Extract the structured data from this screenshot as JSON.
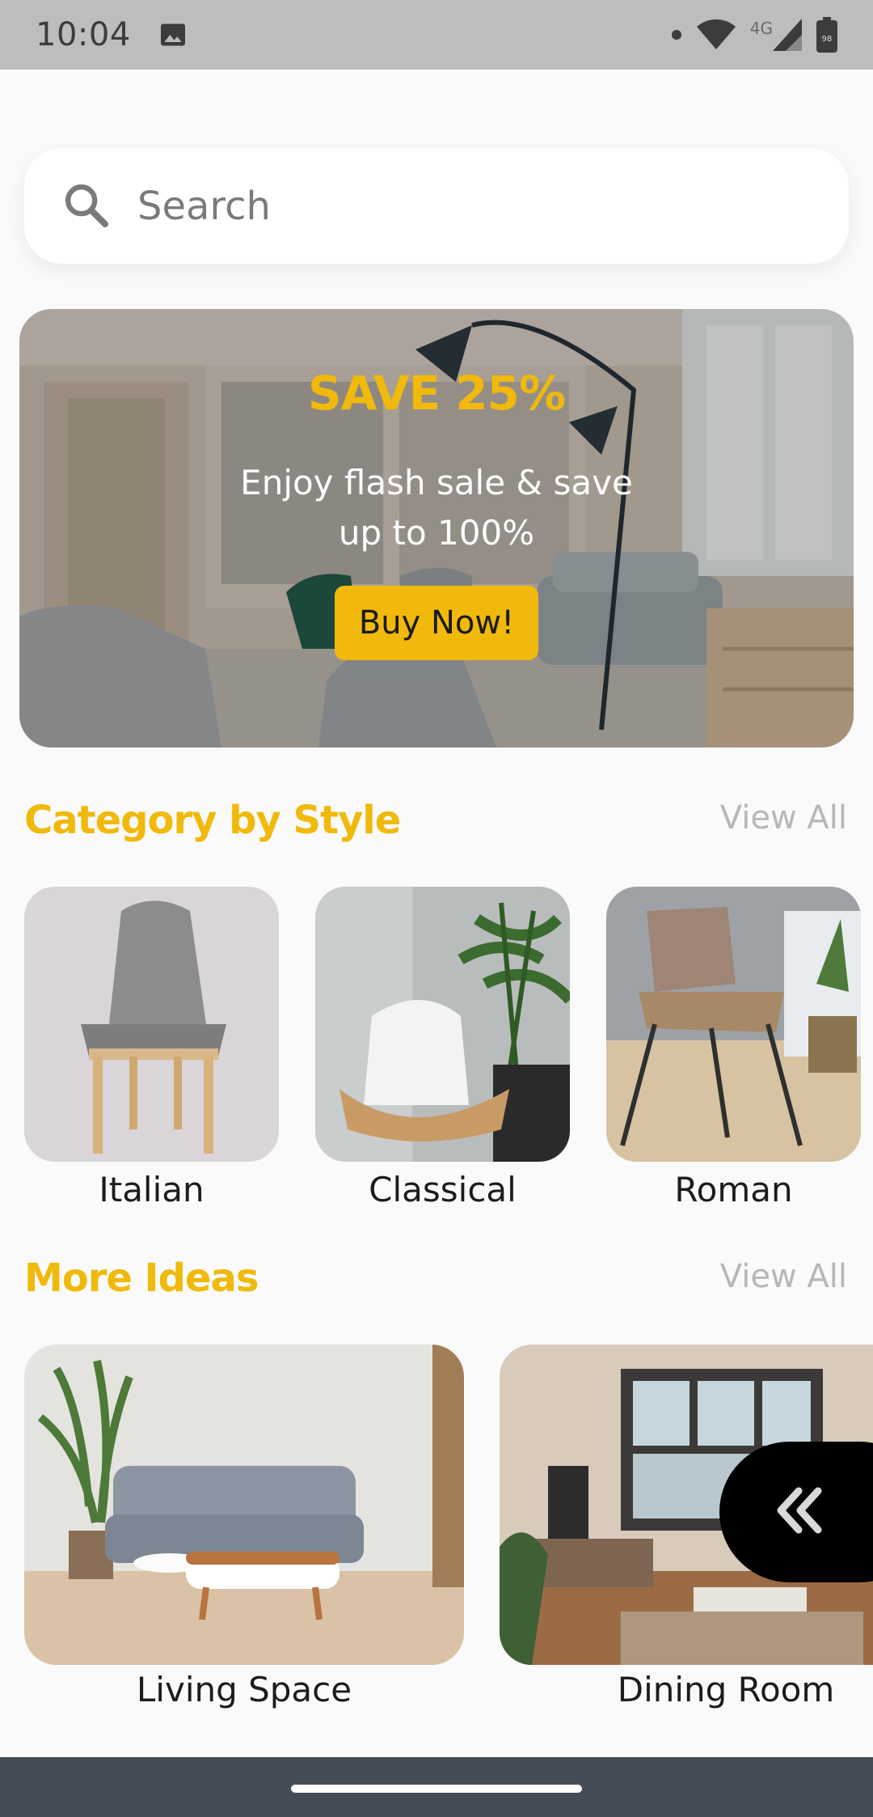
{
  "status_bar": {
    "time": "10:04",
    "network": "4G",
    "battery": "98",
    "icons": [
      "image-icon",
      "dot-icon",
      "wifi-icon",
      "signal-icon",
      "battery-icon"
    ]
  },
  "search": {
    "placeholder": "Search",
    "icon": "search-icon"
  },
  "banner": {
    "title": "SAVE 25%",
    "subtitle": "Enjoy flash sale & save up to 100%",
    "button_label": "Buy Now!"
  },
  "category_section": {
    "title": "Category by Style",
    "view_all": "View All",
    "items": [
      {
        "label": "Italian"
      },
      {
        "label": "Classical"
      },
      {
        "label": "Roman"
      }
    ]
  },
  "ideas_section": {
    "title": "More Ideas",
    "view_all": "View All",
    "items": [
      {
        "label": "Living Space"
      },
      {
        "label": "Dining Room"
      }
    ]
  },
  "float_button": {
    "icon": "double-chevron-left-icon"
  },
  "colors": {
    "accent": "#f0b90b",
    "background": "#fafafa",
    "status_bar": "#bdbdbd",
    "nav_bar": "#454c55",
    "muted_text": "#b7b7b7"
  }
}
